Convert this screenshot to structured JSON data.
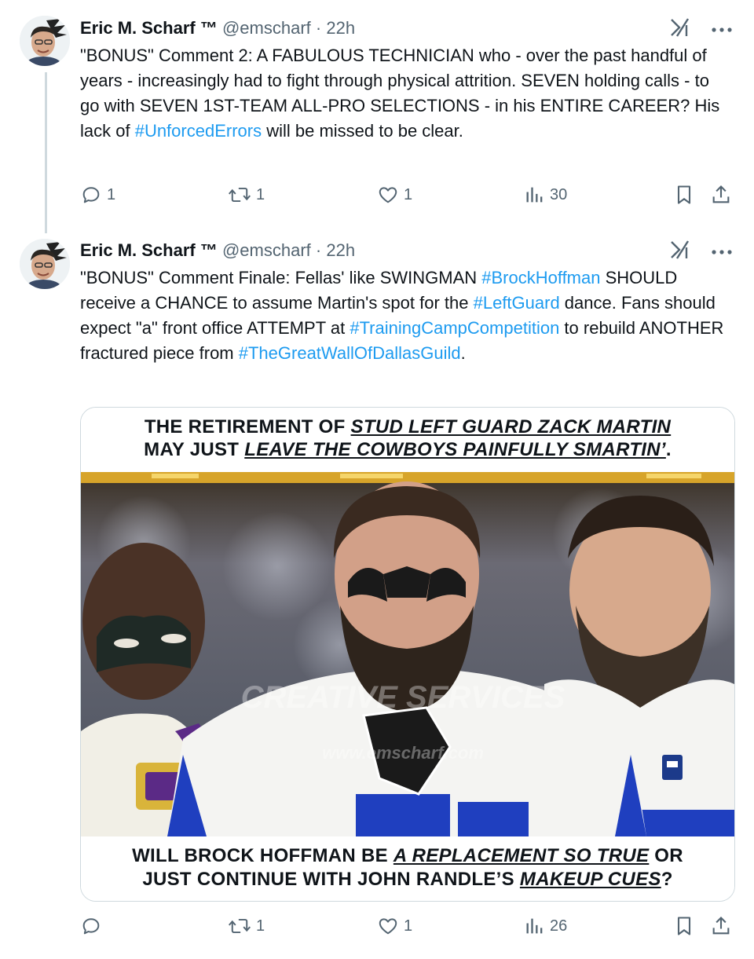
{
  "tweets": [
    {
      "author_name": "Eric M. Scharf ™",
      "handle": "@emscharf",
      "time": "· 22h",
      "text_parts": [
        "\"BONUS\" Comment 2: A FABULOUS TECHNICIAN who - over the past handful of years - increasingly had to fight through physical attrition. SEVEN holding calls - to go with SEVEN 1ST-TEAM ALL-PRO SELECTIONS - in his ENTIRE CAREER? His lack of ",
        "#UnforcedErrors",
        " will be missed to be clear."
      ],
      "replies": "1",
      "reposts": "1",
      "likes": "1",
      "views": "30"
    },
    {
      "author_name": "Eric M. Scharf ™",
      "handle": "@emscharf",
      "time": "· 22h",
      "text_parts": [
        "\"BONUS\" Comment Finale: Fellas' like SWINGMAN ",
        "#BrockHoffman",
        " SHOULD receive a CHANCE to assume Martin's spot for the ",
        "#LeftGuard",
        " dance. Fans should expect \"a\" front office ATTEMPT at ",
        "#TrainingCampCompetition",
        " to rebuild ANOTHER fractured piece from ",
        "#TheGreatWallOfDallasGuild",
        "."
      ],
      "media": {
        "top_line1_plain": "THE RETIREMENT OF ",
        "top_line1_em": "STUD LEFT GUARD ZACK MARTIN",
        "top_line2_plain": "MAY JUST ",
        "top_line2_em": "LEAVE THE COWBOYS PAINFULLY SMARTIN’",
        "top_line2_end": ".",
        "bottom_line1_plain": "WILL BROCK HOFFMAN BE ",
        "bottom_line1_em": "A REPLACEMENT SO TRUE",
        "bottom_line1_end": " OR",
        "bottom_line2_plain": "JUST CONTINUE WITH JOHN RANDLE’S ",
        "bottom_line2_em": "MAKEUP CUES",
        "bottom_line2_end": "?",
        "watermark_1": "CREATIVE SERVICES",
        "watermark_2": "www.emscharf.com"
      },
      "replies": "",
      "reposts": "1",
      "likes": "1",
      "views": "26"
    }
  ],
  "icons": {
    "reply": "reply-icon",
    "repost": "repost-icon",
    "like": "heart-icon",
    "views": "views-icon",
    "bookmark": "bookmark-icon",
    "share": "share-icon",
    "grok": "grok-icon",
    "more": "more-icon"
  },
  "colors": {
    "link": "#1d9bf0",
    "muted": "#536471",
    "text": "#0f1419",
    "jersey_blue": "#1f3fbf"
  }
}
